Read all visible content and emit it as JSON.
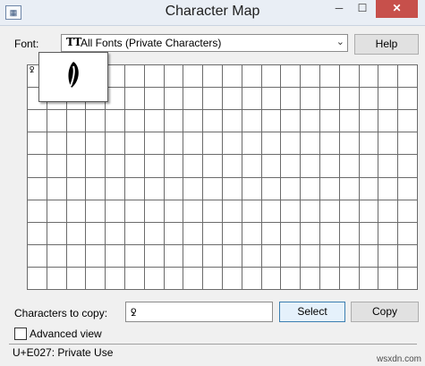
{
  "window": {
    "title": "Character Map",
    "app_icon_name": "character-map-app-icon",
    "min_symbol": "─",
    "max_symbol": "☐",
    "close_symbol": "✕"
  },
  "font": {
    "label": "Font:",
    "selected": "All Fonts (Private Characters)",
    "glyph_icon_text": "TT",
    "dropdown_arrow": "⌄"
  },
  "buttons": {
    "help": "Help",
    "select": "Select",
    "copy": "Copy"
  },
  "grid": {
    "first_cell_glyph": "ꝿ",
    "magnified_glyph_icon": "leaf-glyph-icon"
  },
  "copy": {
    "label": "Characters to copy:",
    "field_value": "ꝿ"
  },
  "advanced": {
    "label": "Advanced view",
    "checked": false
  },
  "status": {
    "text": "U+E027: Private Use"
  },
  "watermark": "wsxdn.com"
}
